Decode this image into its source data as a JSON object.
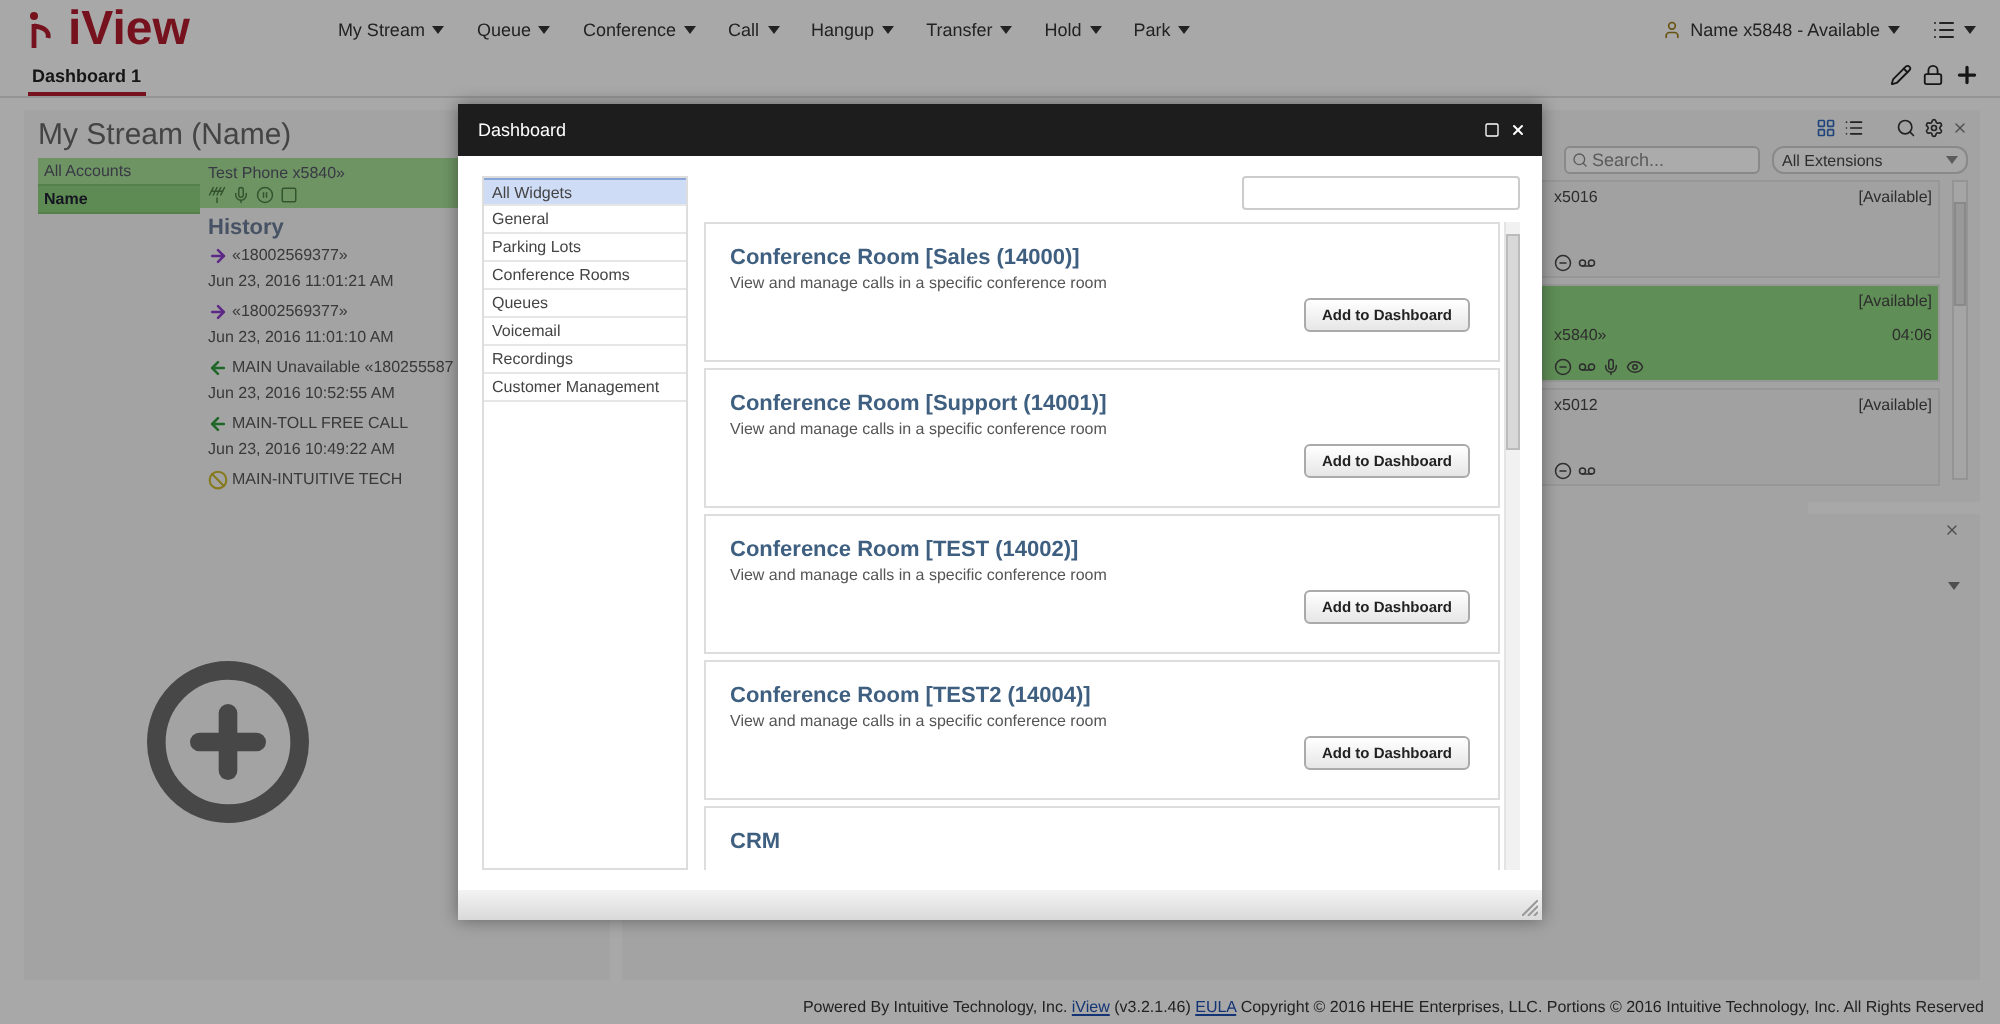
{
  "app": {
    "logo": "iView",
    "menu": [
      "My Stream",
      "Queue",
      "Conference",
      "Call",
      "Hangup",
      "Transfer",
      "Hold",
      "Park"
    ],
    "user_status": "Name x5848 - Available"
  },
  "tabs": [
    {
      "label": "Dashboard 1",
      "selected": true
    }
  ],
  "stream_widget": {
    "title": "My Stream (Name)",
    "accounts_header": "All Accounts",
    "name_header": "Name",
    "phone": "Test Phone x5840»",
    "history_title": "History",
    "history": [
      {
        "kind": "outgoing",
        "caller": "«18002569377»",
        "time": "Jun 23, 2016 11:01:21 AM"
      },
      {
        "kind": "outgoing",
        "caller": "«18002569377»",
        "time": "Jun 23, 2016 11:01:10 AM"
      },
      {
        "kind": "incoming",
        "caller": "MAIN Unavailable «180255587",
        "time": "Jun 23, 2016 10:52:55 AM"
      },
      {
        "kind": "incoming",
        "caller": "MAIN-TOLL FREE CALL",
        "time": "Jun 23, 2016 10:49:22 AM"
      },
      {
        "kind": "blocked",
        "caller": "MAIN-INTUITIVE TECH"
      }
    ]
  },
  "extensions_widget": {
    "search": {
      "placeholder": "Search..."
    },
    "filter": "All Extensions",
    "cards": [
      {
        "extension": "x5016",
        "status": "[Available]",
        "active": false
      },
      {
        "extension": "x5840»",
        "status": "[Available]",
        "timer": "04:06",
        "active": true
      },
      {
        "extension": "x5012",
        "status": "[Available]",
        "active": false
      }
    ]
  },
  "dialog": {
    "title": "Dashboard",
    "categories": [
      {
        "label": "All Widgets",
        "selected": true
      },
      {
        "label": "General",
        "selected": false
      },
      {
        "label": "Parking Lots",
        "selected": false
      },
      {
        "label": "Conference Rooms",
        "selected": false
      },
      {
        "label": "Queues",
        "selected": false
      },
      {
        "label": "Voicemail",
        "selected": false
      },
      {
        "label": "Recordings",
        "selected": false
      },
      {
        "label": "Customer Management",
        "selected": false
      }
    ],
    "widgets": [
      {
        "title": "Conference Room [Sales (14000)]",
        "description": "View and manage calls in a specific conference room",
        "button": "Add to Dashboard"
      },
      {
        "title": "Conference Room [Support (14001)]",
        "description": "View and manage calls in a specific conference room",
        "button": "Add to Dashboard"
      },
      {
        "title": "Conference Room [TEST (14002)]",
        "description": "View and manage calls in a specific conference room",
        "button": "Add to Dashboard"
      },
      {
        "title": "Conference Room [TEST2 (14004)]",
        "description": "View and manage calls in a specific conference room",
        "button": "Add to Dashboard"
      },
      {
        "title": "CRM"
      }
    ]
  },
  "footer": [
    {
      "kind": "text",
      "text": "Powered By Intuitive Technology, Inc."
    },
    {
      "kind": "link",
      "text": "iView"
    },
    {
      "kind": "text",
      "text": "(v3.2.1.46)"
    },
    {
      "kind": "link",
      "text": "EULA"
    },
    {
      "kind": "text",
      "text": "Copyright © 2016 HEHE Enterprises, LLC. Portions © 2016 Intuitive Technology, Inc. All Rights Reserved"
    }
  ]
}
